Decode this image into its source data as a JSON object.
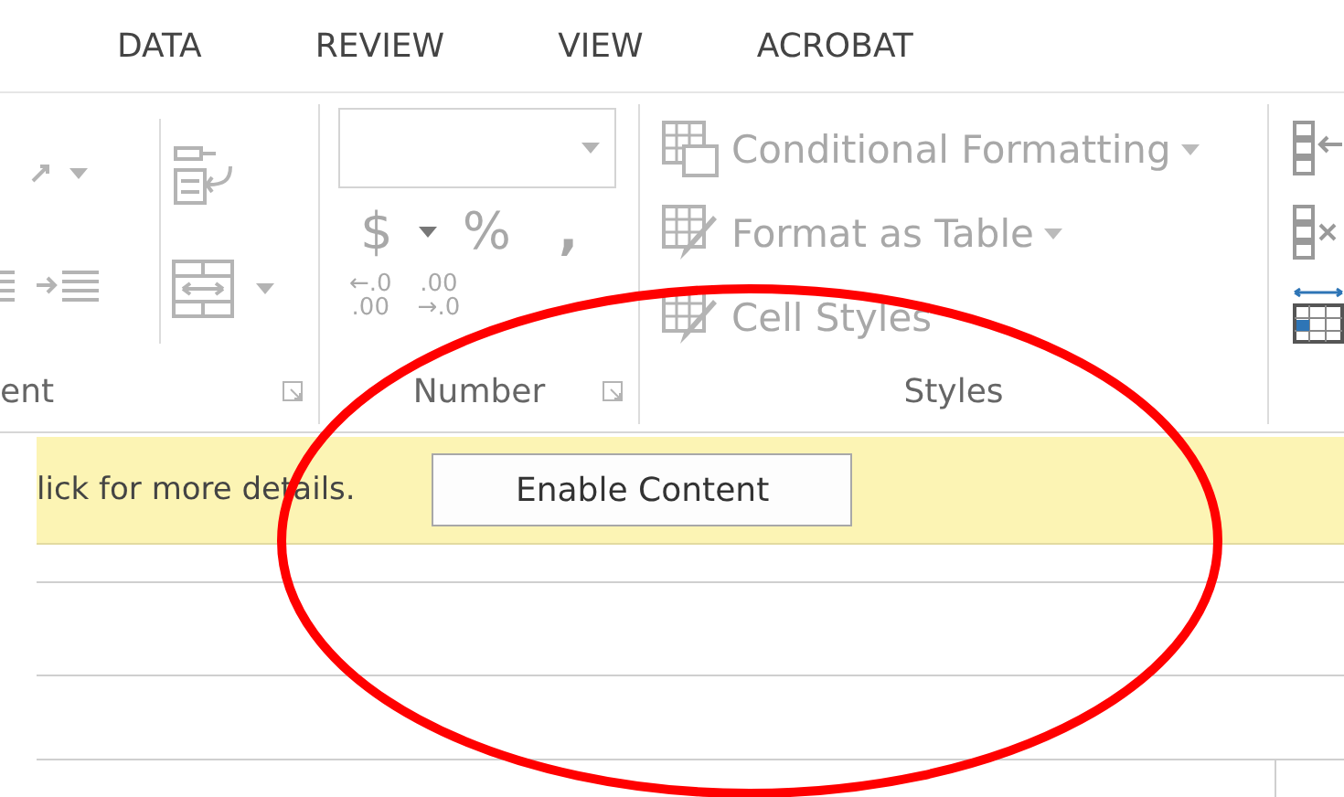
{
  "tabs": [
    {
      "label": "DATA"
    },
    {
      "label": "REVIEW"
    },
    {
      "label": "VIEW"
    },
    {
      "label": "ACROBAT"
    }
  ],
  "ribbon": {
    "disabled": true,
    "groups": [
      {
        "kind": "alignment",
        "label": "ent"
      },
      {
        "kind": "number",
        "label": "Number",
        "symbols": [
          "$",
          "%",
          ","
        ],
        "decimals": [
          {
            "top": "←.0",
            "bottom": ".00"
          },
          {
            "top": ".00",
            "bottom": "→.0"
          }
        ]
      },
      {
        "kind": "styles",
        "label": "Styles",
        "commands": [
          {
            "label": "Conditional Formatting",
            "dropdown": true
          },
          {
            "label": "Format as Table",
            "dropdown": true
          },
          {
            "label": "Cell Styles",
            "dropdown": false
          }
        ]
      },
      {
        "kind": "cells"
      }
    ]
  },
  "message_bar": {
    "text": "lick for more details.",
    "button": "Enable Content"
  },
  "annotation": {
    "kind": "ellipse"
  }
}
